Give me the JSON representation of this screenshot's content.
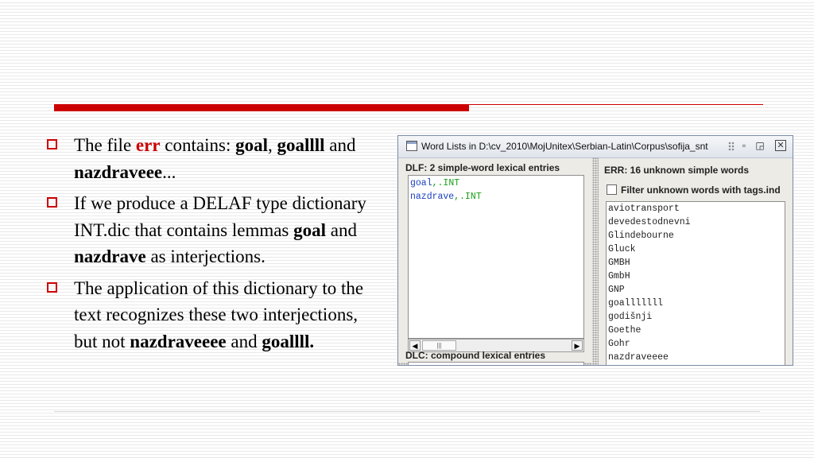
{
  "bullets": {
    "b1": {
      "t1": "The file ",
      "t2": "err",
      "t3": " contains: ",
      "t4": "goal",
      "t5": ", ",
      "t6": "goallll",
      "t7": " and ",
      "t8": "nazdraveee",
      "t9": "..."
    },
    "b2": {
      "t1": "If we produce a DELAF type dictionary INT.dic that contains lemmas ",
      "t2": "goal",
      "t3": " and ",
      "t4": "nazdrave",
      "t5": " as interjections."
    },
    "b3": {
      "t1": "The application of this dictionary to the text recognizes these two interjections, but not ",
      "t2": "nazdraveeee",
      "t3": " and ",
      "t4": "goallll."
    }
  },
  "window": {
    "title": "Word Lists in D:\\cv_2010\\MojUnitex\\Serbian-Latin\\Corpus\\sofija_snt",
    "dlf_label": "DLF: 2 simple-word lexical entries",
    "dlf_entries": [
      {
        "word": "goal",
        "tag": ",.INT"
      },
      {
        "word": "nazdrave",
        "tag": ",.INT"
      }
    ],
    "dlc_label": "DLC: compound lexical entries",
    "err_label": "ERR: 16 unknown simple words",
    "filter_label": "Filter unknown words with tags.ind",
    "unknown_words": [
      "aviotransport",
      "devedestodnevni",
      "Glindebourne",
      "Gluck",
      "GMBH",
      "GmbH",
      "GNP",
      "goalllllll",
      "godišnji",
      "Goethe",
      "Gohr",
      "nazdraveeee"
    ]
  },
  "colors": {
    "accent": "#cc0000",
    "code_word": "#1a3fbf",
    "code_tag": "#17a017"
  }
}
